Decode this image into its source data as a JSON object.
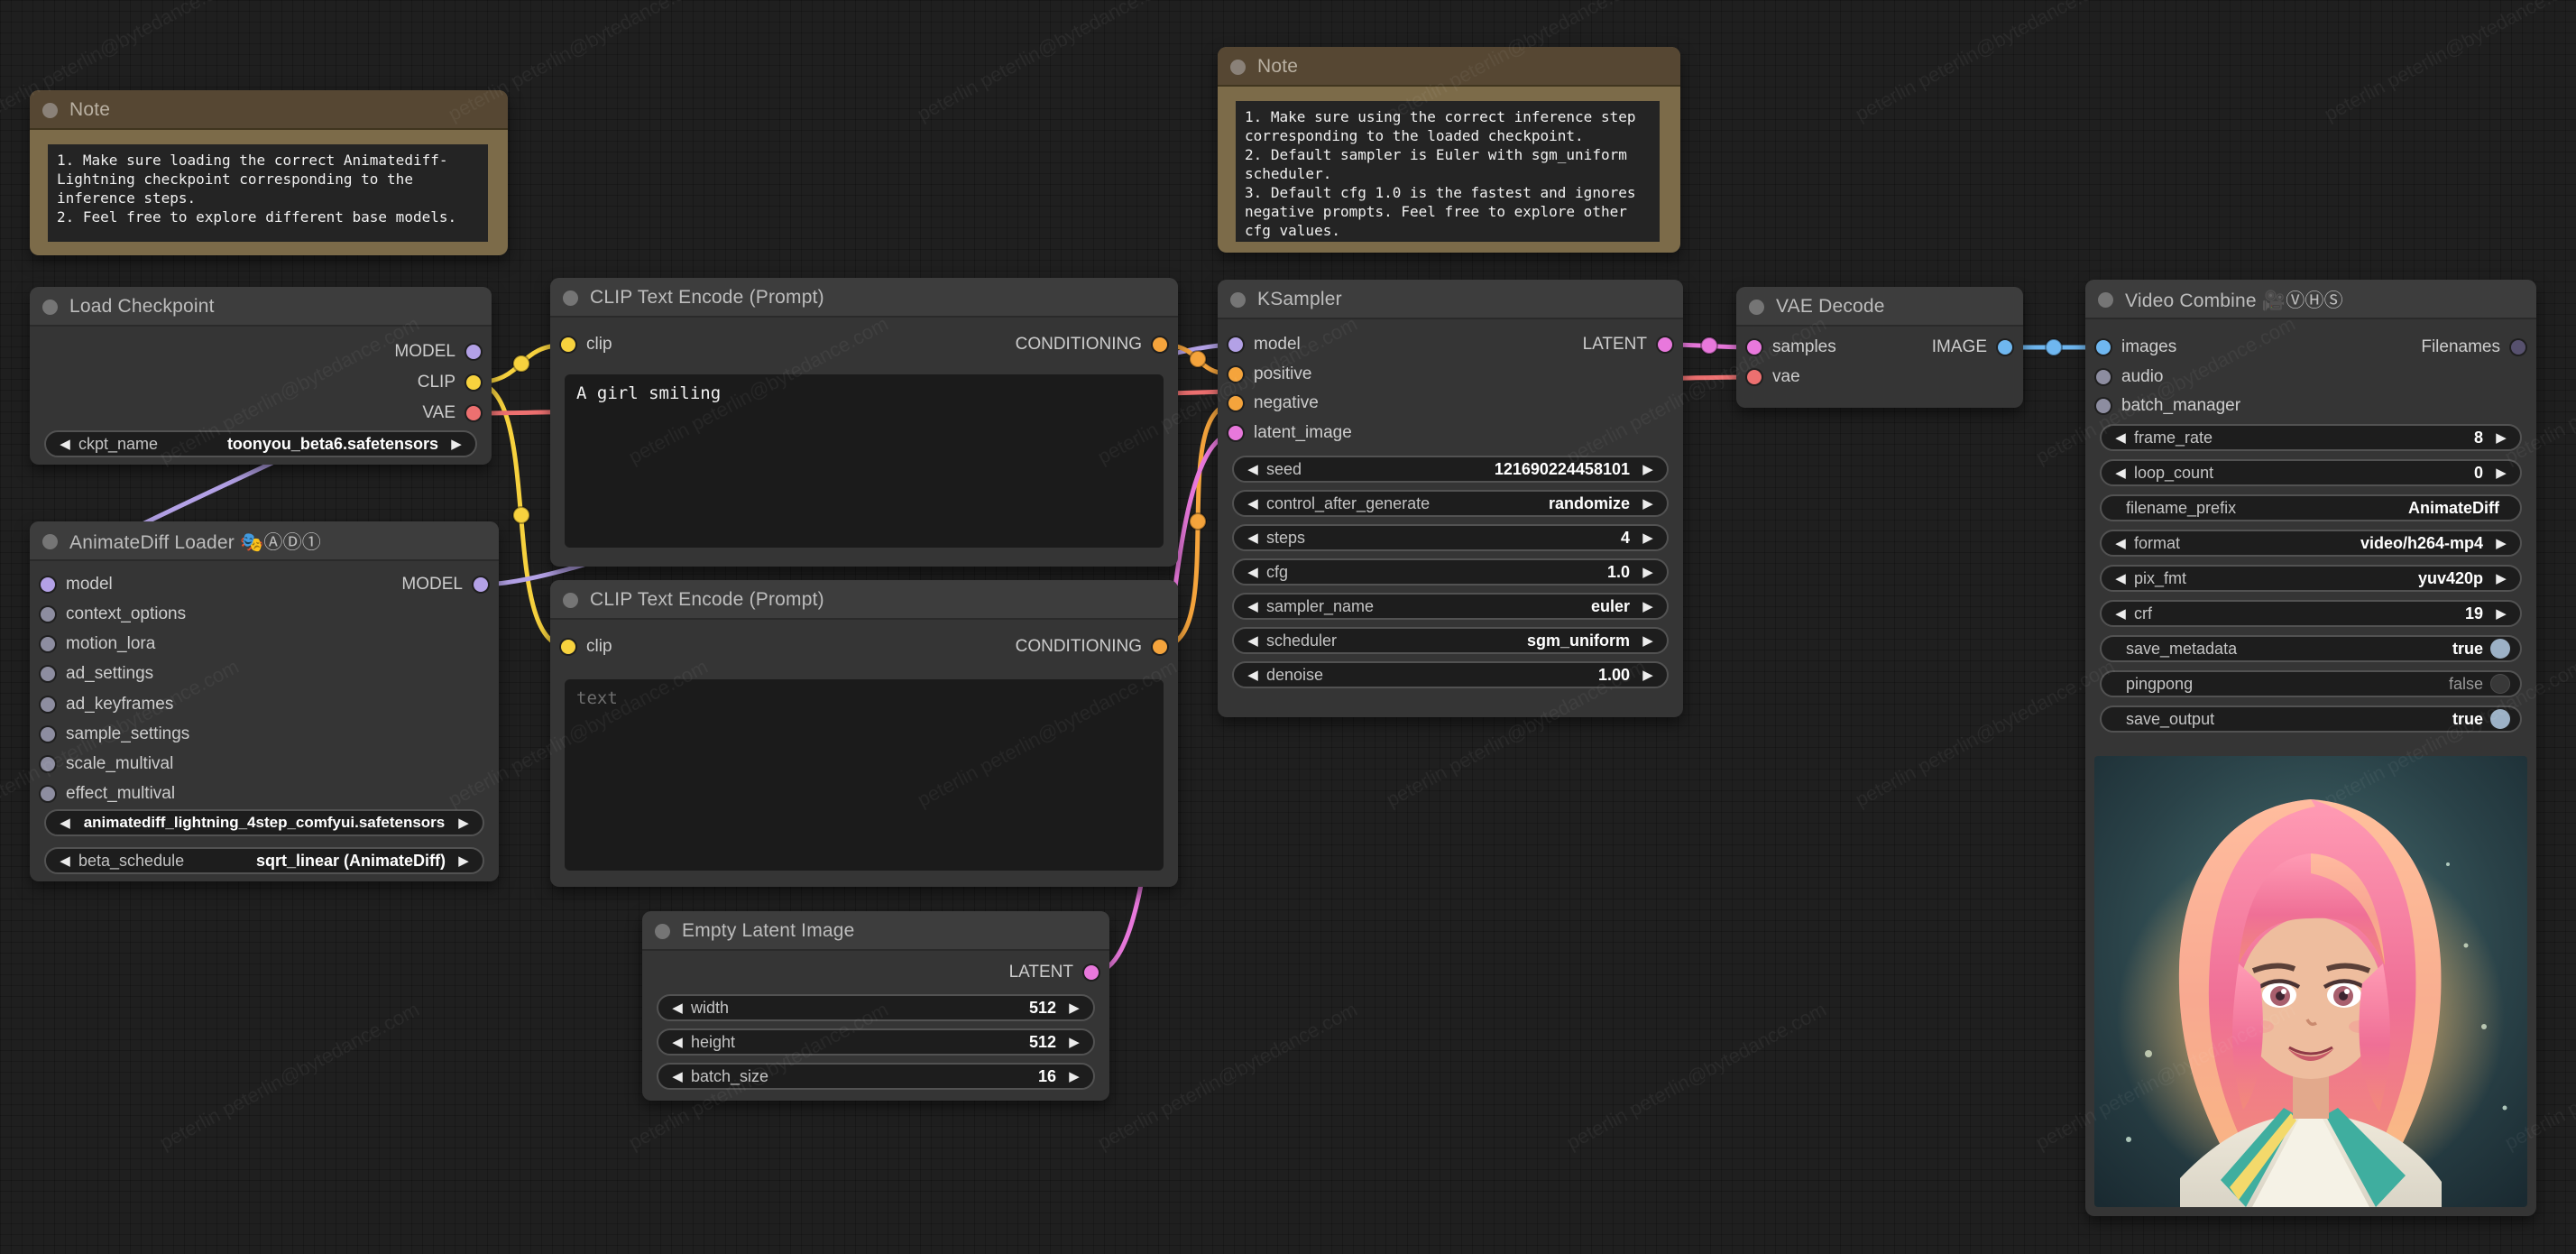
{
  "app": "ComfyUI node graph",
  "watermark": "peterlin peterlin@bytedance.com",
  "port_colors": {
    "MODEL": "#b3a1e6",
    "CLIP": "#f7d23e",
    "VAE": "#ed7070",
    "CONDITIONING": "#f5a43c",
    "LATENT": "#e878dc",
    "IMAGE": "#6fb7f0",
    "OPTIONAL": "#8d8da0",
    "FILENAMES": "#57516e"
  },
  "nodes": {
    "note_left": {
      "title": "Note",
      "text": "1. Make sure loading the correct Animatediff-Lightning checkpoint corresponding to the inference steps.\n2. Feel free to explore different base models."
    },
    "note_mid": {
      "title": "Note",
      "text": "1. Make sure using the correct inference step corresponding to the loaded checkpoint.\n2. Default sampler is Euler with sgm_uniform scheduler.\n3. Default cfg 1.0 is the fastest and ignores negative prompts. Feel free to explore other cfg values."
    },
    "load_checkpoint": {
      "title": "Load Checkpoint",
      "outputs": [
        "MODEL",
        "CLIP",
        "VAE"
      ],
      "widgets": [
        {
          "label": "ckpt_name",
          "value": "toonyou_beta6.safetensors"
        }
      ]
    },
    "animatediff": {
      "title": "AnimateDiff Loader 🎭ⒶⒹ①",
      "inputs": [
        "model",
        "context_options",
        "motion_lora",
        "ad_settings",
        "ad_keyframes",
        "sample_settings",
        "scale_multival",
        "effect_multival"
      ],
      "outputs": [
        "MODEL"
      ],
      "widgets": [
        {
          "label": "",
          "value": "animatediff_lightning_4step_comfyui.safetensors"
        },
        {
          "label": "beta_schedule",
          "value": "sqrt_linear (AnimateDiff)"
        }
      ]
    },
    "clip_positive": {
      "title": "CLIP Text Encode (Prompt)",
      "inputs": [
        "clip"
      ],
      "outputs": [
        "CONDITIONING"
      ],
      "text": "A girl smiling",
      "placeholder": ""
    },
    "clip_negative": {
      "title": "CLIP Text Encode (Prompt)",
      "inputs": [
        "clip"
      ],
      "outputs": [
        "CONDITIONING"
      ],
      "text": "",
      "placeholder": "text"
    },
    "ksampler": {
      "title": "KSampler",
      "inputs": [
        "model",
        "positive",
        "negative",
        "latent_image"
      ],
      "outputs": [
        "LATENT"
      ],
      "widgets": [
        {
          "label": "seed",
          "value": "121690224458101"
        },
        {
          "label": "control_after_generate",
          "value": "randomize"
        },
        {
          "label": "steps",
          "value": "4"
        },
        {
          "label": "cfg",
          "value": "1.0"
        },
        {
          "label": "sampler_name",
          "value": "euler"
        },
        {
          "label": "scheduler",
          "value": "sgm_uniform"
        },
        {
          "label": "denoise",
          "value": "1.00"
        }
      ]
    },
    "vae_decode": {
      "title": "VAE Decode",
      "inputs": [
        "samples",
        "vae"
      ],
      "outputs": [
        "IMAGE"
      ]
    },
    "video_combine": {
      "title": "Video Combine 🎥ⓋⒽⓈ",
      "inputs": [
        "images",
        "audio",
        "batch_manager"
      ],
      "outputs": [
        "Filenames"
      ],
      "widgets": [
        {
          "label": "frame_rate",
          "value": "8"
        },
        {
          "label": "loop_count",
          "value": "0"
        },
        {
          "label": "filename_prefix",
          "value": "AnimateDiff"
        },
        {
          "label": "format",
          "value": "video/h264-mp4"
        },
        {
          "label": "pix_fmt",
          "value": "yuv420p"
        },
        {
          "label": "crf",
          "value": "19"
        },
        {
          "label": "save_metadata",
          "value": "true"
        },
        {
          "label": "pingpong",
          "value": "false"
        },
        {
          "label": "save_output",
          "value": "true"
        }
      ],
      "preview_alt": "animated girl with pink hair smiling"
    },
    "empty_latent": {
      "title": "Empty Latent Image",
      "outputs": [
        "LATENT"
      ],
      "widgets": [
        {
          "label": "width",
          "value": "512"
        },
        {
          "label": "height",
          "value": "512"
        },
        {
          "label": "batch_size",
          "value": "16"
        }
      ]
    }
  }
}
